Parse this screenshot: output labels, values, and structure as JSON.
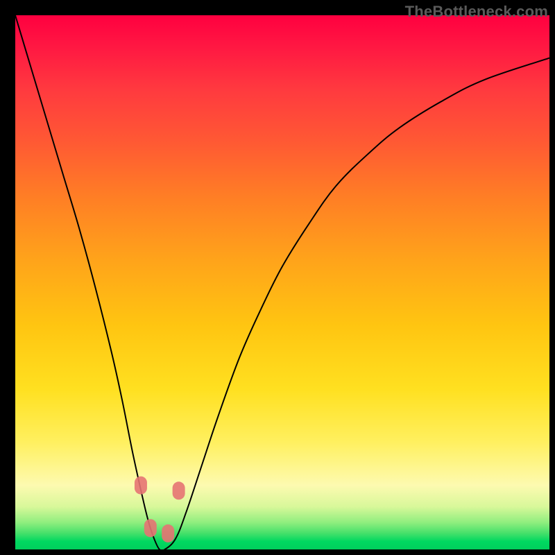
{
  "watermark": "TheBottleneck.com",
  "chart_data": {
    "type": "line",
    "title": "",
    "xlabel": "",
    "ylabel": "",
    "xlim": [
      0,
      100
    ],
    "ylim": [
      0,
      100
    ],
    "grid": false,
    "series": [
      {
        "name": "bottleneck-curve",
        "x": [
          0,
          3,
          6,
          9,
          12,
          15,
          18,
          20,
          22,
          24,
          25,
          26,
          27,
          28,
          30,
          32,
          35,
          38,
          42,
          46,
          50,
          55,
          60,
          66,
          72,
          80,
          88,
          100
        ],
        "y": [
          100,
          90,
          80,
          70,
          60,
          49,
          37,
          28,
          18,
          9,
          5,
          2,
          0,
          0,
          2,
          7,
          16,
          25,
          36,
          45,
          53,
          61,
          68,
          74,
          79,
          84,
          88,
          92
        ]
      }
    ],
    "markers": [
      {
        "x": 23.5,
        "y": 12
      },
      {
        "x": 25.3,
        "y": 4
      },
      {
        "x": 28.6,
        "y": 3
      },
      {
        "x": 30.6,
        "y": 11
      }
    ],
    "gradient_stops": [
      {
        "pos": 0,
        "color": "#ff0040"
      },
      {
        "pos": 0.5,
        "color": "#ffc511"
      },
      {
        "pos": 0.88,
        "color": "#fdfab0"
      },
      {
        "pos": 1.0,
        "color": "#00cf5c"
      }
    ]
  }
}
